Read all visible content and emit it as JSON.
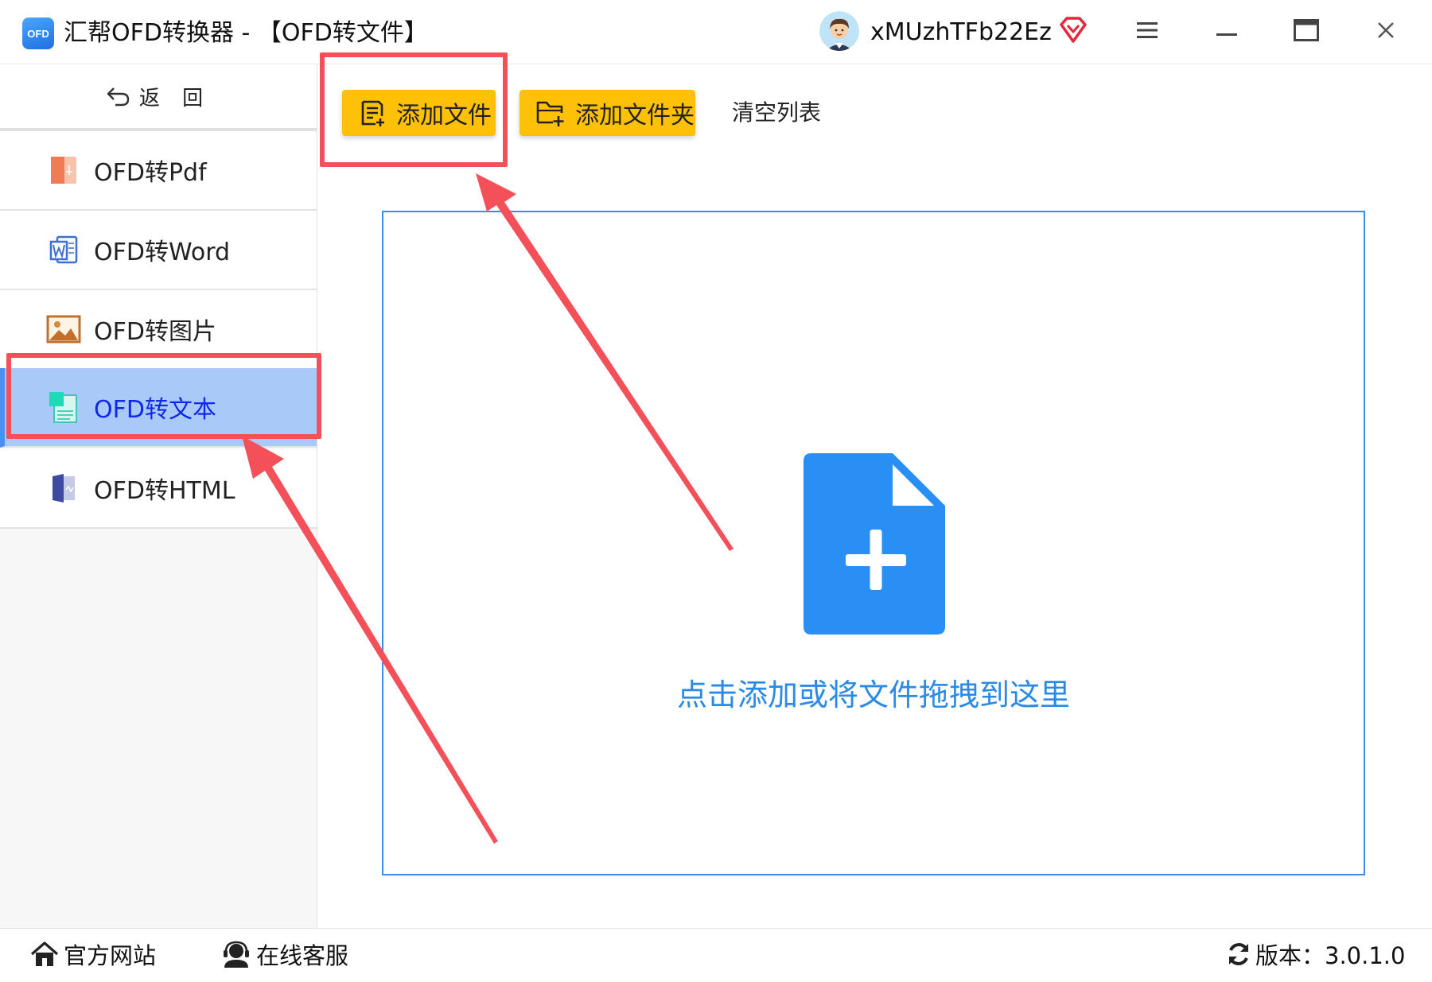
{
  "titlebar": {
    "logo_text": "OFD",
    "title": "汇帮OFD转换器 - 【OFD转文件】",
    "username": "xMUzhTFb22Ez",
    "icons": [
      "avatar",
      "vip-diamond-icon",
      "menu-icon",
      "minimize-icon",
      "maximize-icon",
      "close-icon"
    ]
  },
  "sidebar": {
    "back_label": "返 回",
    "items": [
      {
        "label": "OFD转Pdf",
        "icon": "pdf-file-icon"
      },
      {
        "label": "OFD转Word",
        "icon": "word-file-icon"
      },
      {
        "label": "OFD转图片",
        "icon": "image-file-icon"
      },
      {
        "label": "OFD转文本",
        "icon": "text-file-icon",
        "active": true
      },
      {
        "label": "OFD转HTML",
        "icon": "html-file-icon"
      }
    ]
  },
  "toolbar": {
    "add_file_label": "添加文件",
    "add_folder_label": "添加文件夹",
    "clear_list_label": "清空列表"
  },
  "dropzone": {
    "hint": "点击添加或将文件拖拽到这里"
  },
  "footer": {
    "website_label": "官方网站",
    "support_label": "在线客服",
    "version_label": "版本：3.0.1.0"
  },
  "colors": {
    "accent_yellow": "#ffc107",
    "active_nav_bg": "#a9c9f8",
    "active_nav_text": "#1029e6",
    "dropzone_border": "#3a8de8",
    "dropzone_icon": "#2a8ff5",
    "annotation_red": "#f4505a"
  }
}
